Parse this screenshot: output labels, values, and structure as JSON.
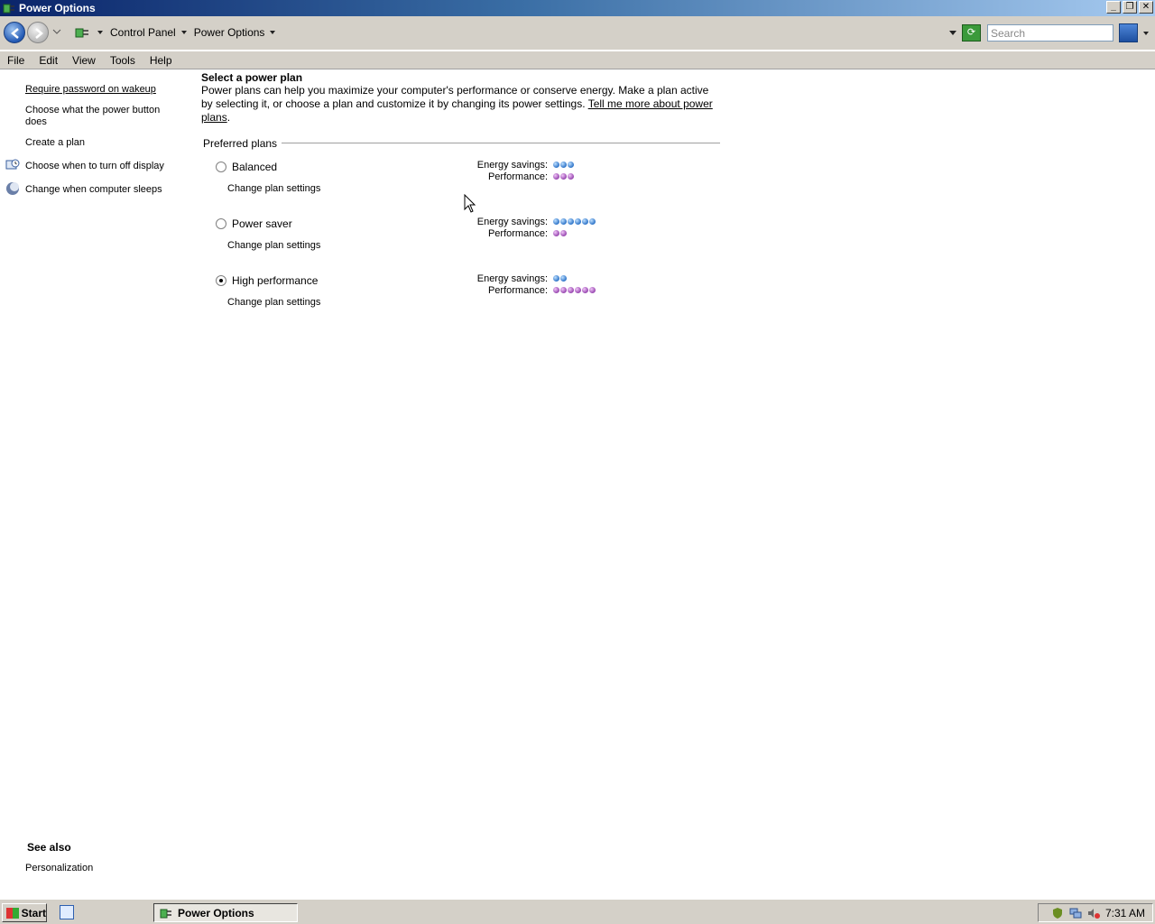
{
  "window": {
    "title": "Power Options"
  },
  "address": {
    "crumbs": [
      "Control Panel",
      "Power Options"
    ],
    "search_placeholder": "Search"
  },
  "menu": [
    "File",
    "Edit",
    "View",
    "Tools",
    "Help"
  ],
  "left_nav": {
    "items": [
      "Require password on wakeup",
      "Choose what the power button does",
      "Create a plan",
      "Choose when to turn off display",
      "Change when computer sleeps"
    ]
  },
  "main": {
    "title": "Select a power plan",
    "description": "Power plans can help you maximize your computer's performance or conserve energy. Make a plan active by selecting it, or choose a plan and customize it by changing its power settings. ",
    "more_link": "Tell me more about power plans",
    "section": "Preferred plans",
    "energy_label": "Energy savings:",
    "performance_label": "Performance:",
    "change_label": "Change plan settings",
    "plans": [
      {
        "name": "Balanced",
        "selected": false,
        "energy": 3,
        "performance": 3
      },
      {
        "name": "Power saver",
        "selected": false,
        "energy": 6,
        "performance": 2
      },
      {
        "name": "High performance",
        "selected": true,
        "energy": 2,
        "performance": 6
      }
    ]
  },
  "see_also": {
    "title": "See also",
    "links": [
      "Personalization"
    ]
  },
  "taskbar": {
    "start": "Start",
    "task": "Power Options",
    "clock": "7:31 AM"
  },
  "colors": {
    "energy": "#2e74c8",
    "performance": "#9848b0"
  }
}
